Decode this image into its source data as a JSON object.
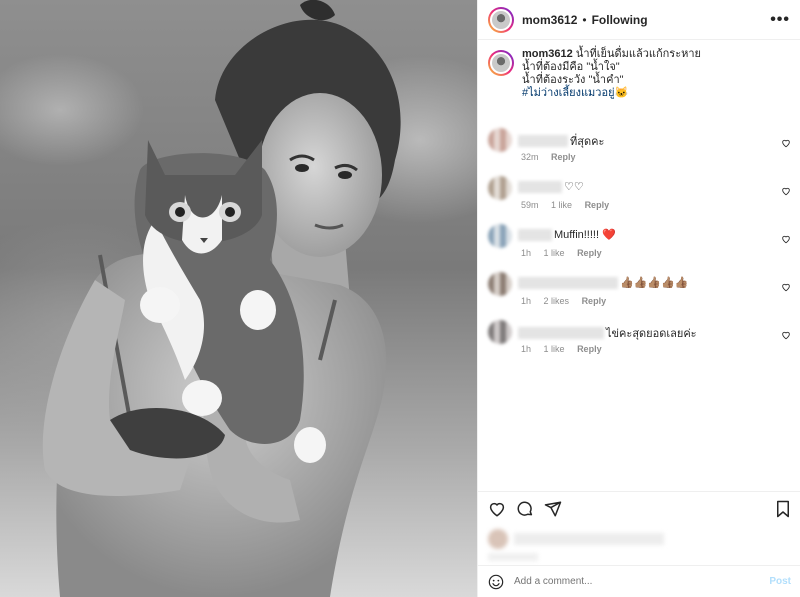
{
  "post": {
    "username": "mom3612",
    "separator": "•",
    "follow_status": "Following",
    "more": "•••"
  },
  "caption": {
    "username": "mom3612",
    "line1": "น้ำที่เย็นดื่มแล้วแก้กระหาย",
    "line2": "น้ำที่ต้องมีคือ \"น้ำใจ\"",
    "line3": "น้ำที่ต้องระวัง \"น้ำคำ\"",
    "hashtag": "#ไม่ว่างเลี้ยงแมวอยู่🐱"
  },
  "comments": [
    {
      "text": "ที่สุดคะ",
      "time": "32m",
      "likes": "",
      "reply": "Reply"
    },
    {
      "text": "♡♡",
      "time": "59m",
      "likes": "1 like",
      "reply": "Reply"
    },
    {
      "text": "Muffin!!!!! ❤️",
      "time": "1h",
      "likes": "1 like",
      "reply": "Reply"
    },
    {
      "text": "👍🏽👍🏽👍🏽👍🏽👍🏽",
      "time": "1h",
      "likes": "2 likes",
      "reply": "Reply"
    },
    {
      "text": "ไข่คะสุดยอดเลยค่ะ",
      "time": "1h",
      "likes": "1 like",
      "reply": "Reply"
    }
  ],
  "add_comment": {
    "placeholder": "Add a comment...",
    "post_label": "Post"
  },
  "icons": [
    "heart-icon",
    "comment-icon",
    "share-icon",
    "bookmark-icon",
    "emoji-icon",
    "more-icon"
  ],
  "colors": {
    "link": "#00376b",
    "muted": "#8e8e8e",
    "post_disabled": "#b2dffc"
  }
}
